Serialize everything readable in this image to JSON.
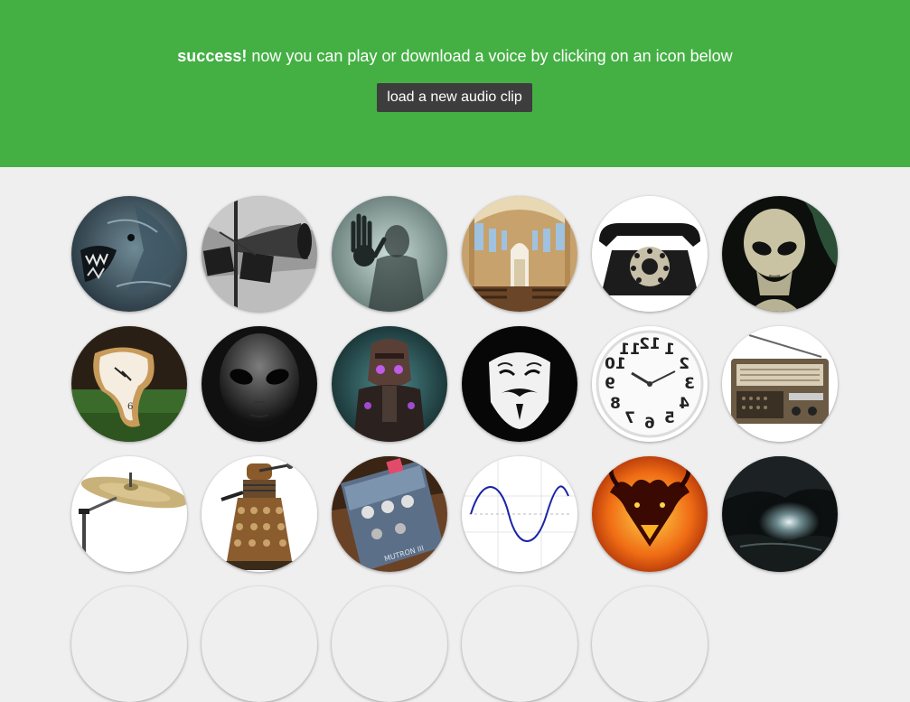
{
  "header": {
    "success_label": "success!",
    "message": " now you can play or download a voice by clicking on an icon below",
    "load_button_label": "load a new audio clip",
    "background_color": "#44b044"
  },
  "voices": [
    {
      "icon": "monster-roar-icon"
    },
    {
      "icon": "megaphone-speakers-icon"
    },
    {
      "icon": "ghost-hand-icon"
    },
    {
      "icon": "cathedral-icon"
    },
    {
      "icon": "rotary-telephone-icon"
    },
    {
      "icon": "alien-icon"
    },
    {
      "icon": "melting-clock-icon"
    },
    {
      "icon": "grey-alien-icon"
    },
    {
      "icon": "robot-icon"
    },
    {
      "icon": "anonymous-mask-icon"
    },
    {
      "icon": "reversed-clock-icon"
    },
    {
      "icon": "radio-icon"
    },
    {
      "icon": "cymbal-icon"
    },
    {
      "icon": "dalek-icon"
    },
    {
      "icon": "effects-pedal-icon"
    },
    {
      "icon": "sine-wave-icon"
    },
    {
      "icon": "fire-demon-icon"
    },
    {
      "icon": "cave-icon"
    }
  ],
  "clock_numbers": [
    "12",
    "1",
    "2",
    "3",
    "4",
    "5",
    "6",
    "7",
    "8",
    "9",
    "10",
    "11"
  ],
  "pedal_label": "MUTRON III"
}
